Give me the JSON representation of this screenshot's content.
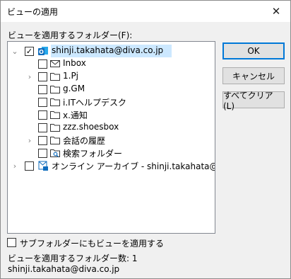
{
  "window": {
    "title": "ビューの適用"
  },
  "folder_label": "ビューを適用するフォルダー(F):",
  "tree": {
    "root": {
      "label": "shinji.takahata@diva.co.jp",
      "checked": true,
      "icon": "outlook-account-icon"
    },
    "items": [
      {
        "label": "Inbox",
        "icon": "mail-icon",
        "expandable": false
      },
      {
        "label": "1.Pj",
        "icon": "folder-icon",
        "expandable": true
      },
      {
        "label": "g.GM",
        "icon": "folder-icon",
        "expandable": false
      },
      {
        "label": "i.ITヘルプデスク",
        "icon": "folder-icon",
        "expandable": false
      },
      {
        "label": "x.通知",
        "icon": "folder-icon",
        "expandable": false
      },
      {
        "label": "zzz.shoesbox",
        "icon": "folder-icon",
        "expandable": false
      },
      {
        "label": "会話の履歴",
        "icon": "folder-icon",
        "expandable": true
      },
      {
        "label": "検索フォルダー",
        "icon": "search-folder-icon",
        "expandable": false
      }
    ],
    "archive": {
      "label": "オンライン アーカイブ - shinji.takahata@diva.co.jp",
      "icon": "archive-account-icon",
      "expandable": true
    }
  },
  "buttons": {
    "ok": "OK",
    "cancel": "キャンセル",
    "clear_all": "すべてクリア(L)"
  },
  "apply_subfolders_label": "サブフォルダーにもビューを適用する",
  "count_text": "ビューを適用するフォルダー数: 1",
  "selected_folder": "shinji.takahata@diva.co.jp",
  "colors": {
    "selection": "#cce8ff",
    "accent": "#0078d7",
    "outlook_blue": "#0f6cbd"
  }
}
